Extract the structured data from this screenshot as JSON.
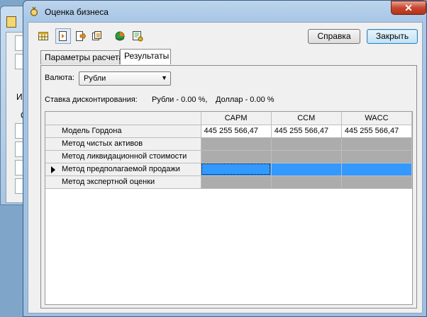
{
  "window": {
    "title": "Оценка бизнеса"
  },
  "background_window": {
    "visible_chars": [
      "И",
      "О"
    ]
  },
  "toolbar": {
    "icons": [
      "table-icon",
      "open-icon",
      "export-icon",
      "save-all-icon",
      "chart-icon",
      "settings-icon"
    ],
    "help_label": "Справка",
    "close_label": "Закрыть"
  },
  "tabs": [
    {
      "label": "Параметры расчета",
      "active": false
    },
    {
      "label": "Результаты",
      "active": true
    }
  ],
  "results": {
    "currency_label": "Валюта:",
    "currency_value": "Рубли",
    "discount_label": "Ставка дисконтирования:",
    "discount_rub": "Рубли -  0.00 %,",
    "discount_usd": "Доллар -  0.00 %",
    "grid": {
      "columns": [
        "CAPM",
        "CCM",
        "WACC"
      ],
      "rows": [
        {
          "label": "Модель Гордона",
          "values": [
            "445 255 566,47",
            "445 255 566,47",
            "445 255 566,47"
          ],
          "state": "value"
        },
        {
          "label": "Метод чистых активов",
          "values": [
            "",
            "",
            ""
          ],
          "state": "disabled"
        },
        {
          "label": "Метод ликвидационной стоимости",
          "values": [
            "",
            "",
            ""
          ],
          "state": "disabled"
        },
        {
          "label": "Метод предполагаемой продажи",
          "values": [
            "",
            "",
            ""
          ],
          "state": "selected"
        },
        {
          "label": "Метод экспертной оценки",
          "values": [
            "",
            "",
            ""
          ],
          "state": "disabled"
        }
      ]
    }
  }
}
